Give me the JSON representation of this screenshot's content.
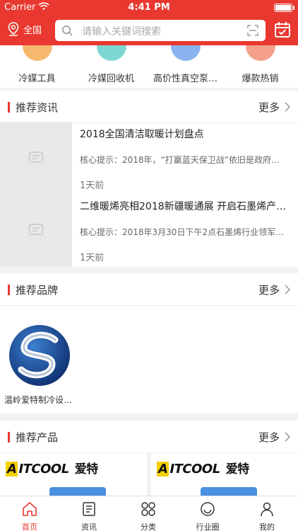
{
  "status_bar": {
    "carrier": "Carrier",
    "time": "4:41 PM"
  },
  "header": {
    "location": "全国",
    "search_placeholder": "请输入关键词搜索"
  },
  "categories": [
    {
      "label": "冷媒工具",
      "color": "#f5b86e"
    },
    {
      "label": "冷媒回收机",
      "color": "#7fd7d3"
    },
    {
      "label": "高价性真空泵…",
      "color": "#8ab4f0"
    },
    {
      "label": "爆款热销",
      "color": "#f4a08a"
    }
  ],
  "news_section": {
    "title": "推荐资讯",
    "more": "更多",
    "items": [
      {
        "title": "2018全国清洁取暖计划盘点",
        "summary": "核心提示：2018年，“打赢蓝天保卫战”依旧是政府…",
        "time": "1天前"
      },
      {
        "title": "二维暖烯亮相2018新疆暖通展 开启石墨烯产…",
        "summary": "核心提示：2018年3月30日下午2点石墨烯行业领军…",
        "time": "1天前"
      }
    ]
  },
  "brand_section": {
    "title": "推荐品牌",
    "more": "更多",
    "brands": [
      {
        "name": "温岭爱特制冷设…"
      }
    ]
  },
  "product_section": {
    "title": "推荐产品",
    "more": "更多",
    "products": [
      {
        "logo": "ITCOOL",
        "logo_initial": "A",
        "logo_cn": "爱特"
      },
      {
        "logo": "ITCOOL",
        "logo_initial": "A",
        "logo_cn": "爱特"
      }
    ]
  },
  "tabbar": {
    "items": [
      {
        "label": "首页",
        "active": true
      },
      {
        "label": "资讯",
        "active": false
      },
      {
        "label": "分类",
        "active": false
      },
      {
        "label": "行业圈",
        "active": false
      },
      {
        "label": "我的",
        "active": false
      }
    ]
  },
  "colors": {
    "accent": "#e8382f"
  }
}
